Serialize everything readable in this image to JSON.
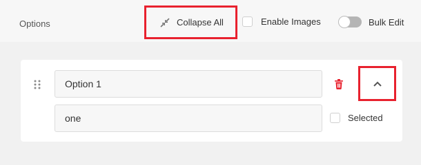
{
  "header": {
    "title": "Options",
    "collapse_all_label": "Collapse All",
    "enable_images_label": "Enable Images",
    "bulk_edit_label": "Bulk Edit"
  },
  "option": {
    "label_value": "Option 1",
    "value_value": "one",
    "selected_label": "Selected",
    "selected_checked": false
  },
  "bulk_edit_enabled": false,
  "enable_images_checked": false,
  "colors": {
    "highlight": "#e8212e",
    "delete_icon": "#e8212e",
    "toggle_track": "#b5b5b5"
  },
  "icons": {
    "collapse": "collapse-arrows-icon",
    "drag": "drag-handle-icon",
    "delete": "trash-icon",
    "expand": "chevron-up-icon"
  }
}
